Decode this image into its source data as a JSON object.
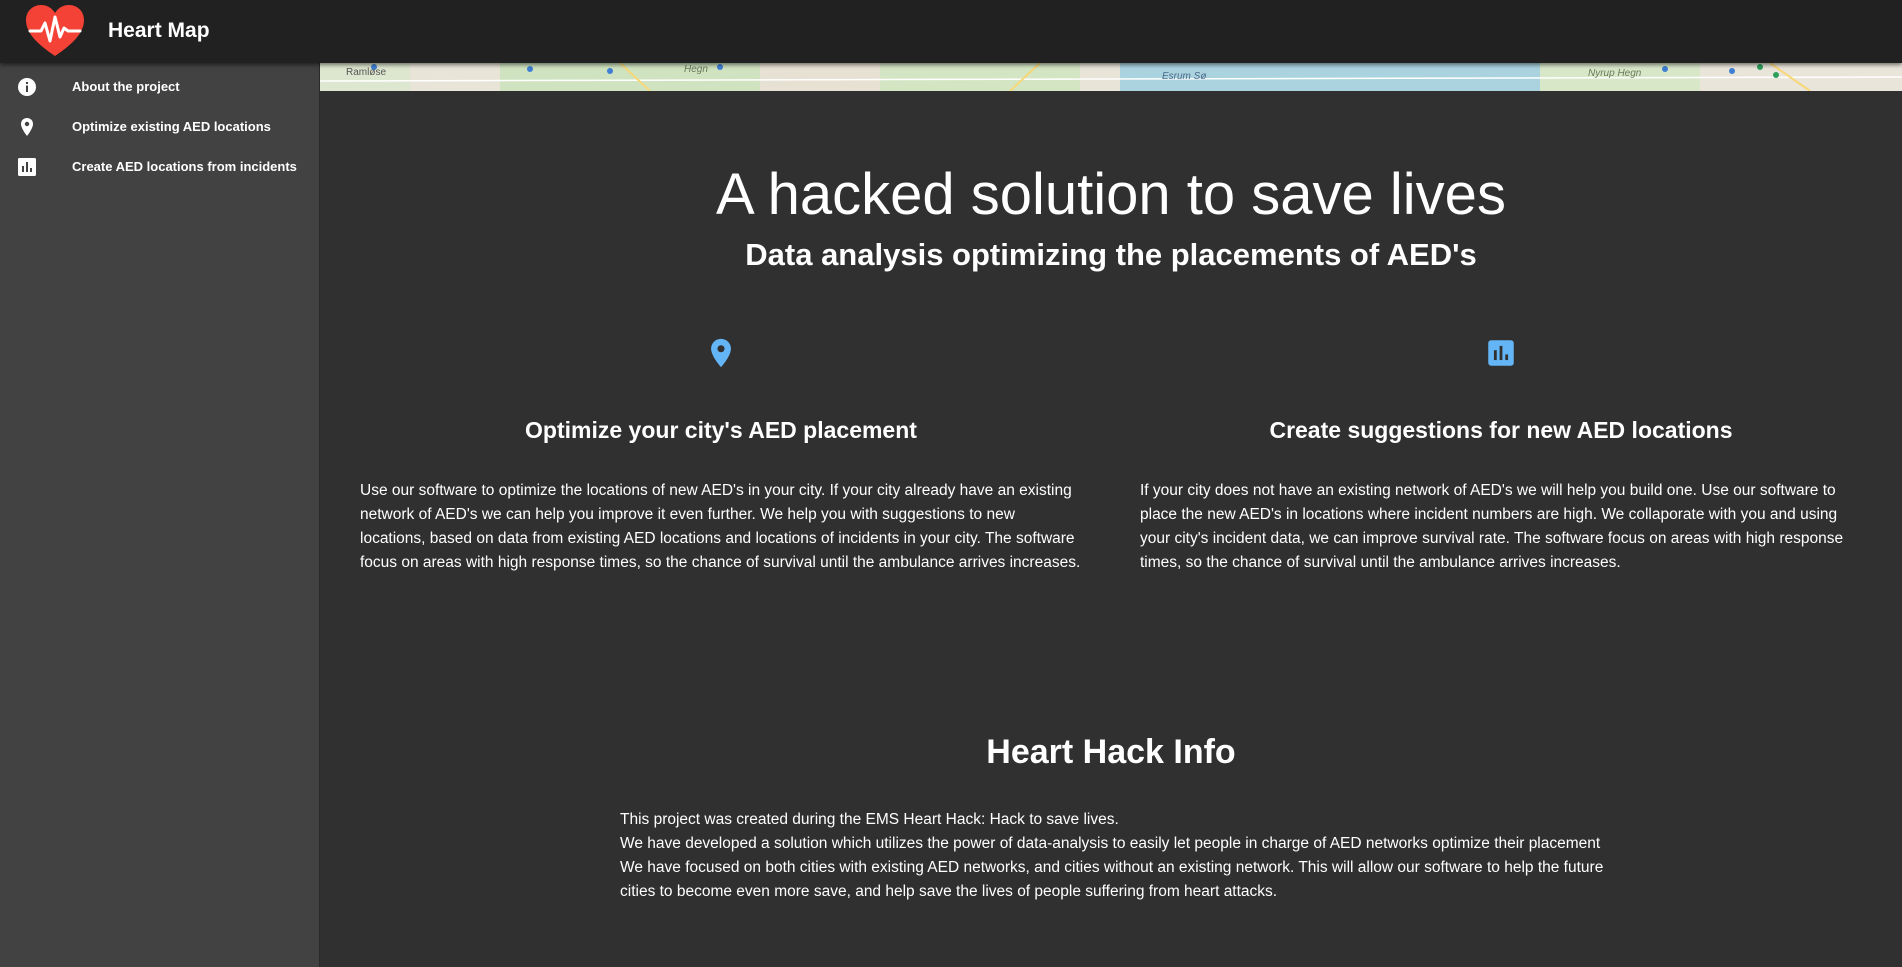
{
  "header": {
    "app_title": "Heart Map",
    "logo_icon": "heart-pulse-icon",
    "accent_color": "#f44336"
  },
  "sidebar": {
    "items": [
      {
        "label": "About the project",
        "icon": "info-icon"
      },
      {
        "label": "Optimize existing AED locations",
        "icon": "map-pin-icon"
      },
      {
        "label": "Create AED locations from incidents",
        "icon": "bar-chart-icon"
      }
    ]
  },
  "map": {
    "labels": [
      "Ramløse",
      "Hegn",
      "Esrum Sø",
      "Nyrup Hegn"
    ]
  },
  "hero": {
    "title": "A hacked solution to save lives",
    "subtitle": "Data analysis optimizing the placements of AED's"
  },
  "features": [
    {
      "icon": "map-pin-icon",
      "title": "Optimize your city's AED placement",
      "text": "Use our software to optimize the locations of new AED's in your city. If your city already have an existing network of AED's we can help you improve it even further. We help you with suggestions to new locations, based on data from existing AED locations and locations of incidents in your city. The software focus on areas with high response times, so the chance of survival until the ambulance arrives increases."
    },
    {
      "icon": "bar-chart-icon",
      "title": "Create suggestions for new AED locations",
      "text": "If your city does not have an existing network of AED's we will help you build one. Use our software to place the new AED's in locations where incident numbers are high. We collaporate with you and using your city's incident data, we can improve survival rate. The software focus on areas with high response times, so the chance of survival until the ambulance arrives increases."
    }
  ],
  "info": {
    "title": "Heart Hack Info",
    "paragraphs": [
      "This project was created during the EMS Heart Hack: Hack to save lives.",
      "We have developed a solution which utilizes the power of data-analysis to easily let people in charge of AED networks optimize their placement",
      "We have focused on both cities with existing AED networks, and cities without an existing network. This will allow our software to help the future cities to become even more save, and help save the lives of people suffering from heart attacks."
    ]
  },
  "colors": {
    "topbar": "#212121",
    "sidebar": "#424242",
    "content": "#303030",
    "icon_blue": "#64b5f6"
  }
}
